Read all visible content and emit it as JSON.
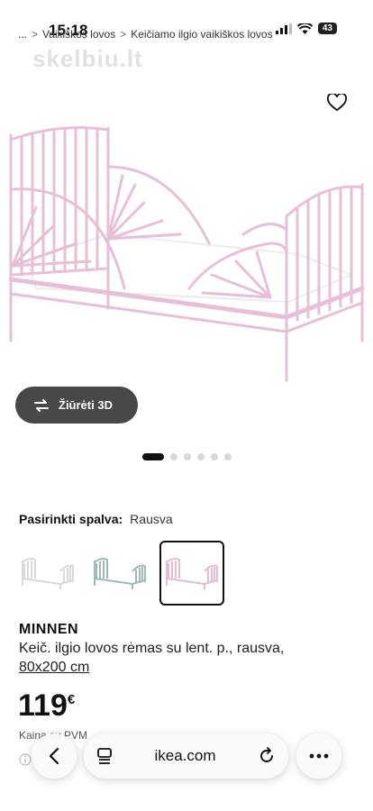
{
  "status_bar": {
    "time": "15:18",
    "battery": "43"
  },
  "breadcrumb": {
    "items": [
      "...",
      "Vaikiškos lovos",
      "Keičiamo ilgio vaikiškos lovos"
    ],
    "separator": ">"
  },
  "watermark": {
    "text": "skelbiu.lt"
  },
  "gallery": {
    "view3d_label": "Žiūrėti 3D",
    "dot_count": 6,
    "active_dot": 0
  },
  "color_select": {
    "label": "Pasirinkti spalva:",
    "value": "Rausva"
  },
  "swatches": [
    {
      "name": "white",
      "color": "#e6e6e6",
      "selected": false
    },
    {
      "name": "light-blue",
      "color": "#9fb9bb",
      "selected": false
    },
    {
      "name": "pink",
      "color": "#e3bcd2",
      "selected": true
    }
  ],
  "product": {
    "name": "MINNEN",
    "description": "Keič. ilgio lovos rėmas su lent. p., rausva,",
    "size": "80x200 cm",
    "price": "119",
    "currency": "€",
    "vat_note": "Kaina su PVM"
  },
  "browser": {
    "url": "ikea.com"
  },
  "colors": {
    "bed_frame": "#e7bfd6",
    "accent_dark": "#484848"
  }
}
